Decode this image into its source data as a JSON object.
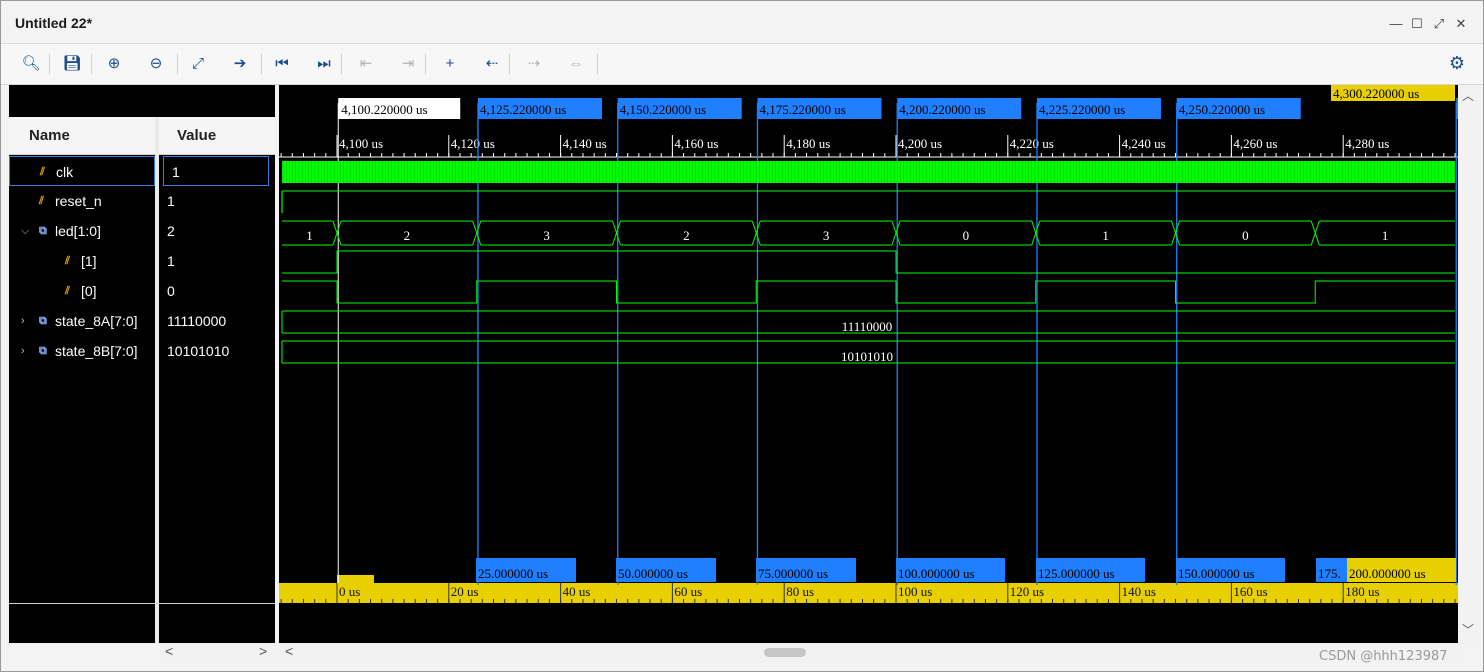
{
  "window": {
    "title": "Untitled 22*"
  },
  "toolbar": {
    "buttons": [
      {
        "name": "zoom-search-icon",
        "glyph": "🔍︎"
      },
      {
        "name": "save-icon",
        "glyph": "💾︎"
      },
      {
        "name": "zoom-in-icon",
        "glyph": "⊕"
      },
      {
        "name": "zoom-out-icon",
        "glyph": "⊖"
      },
      {
        "name": "zoom-fit-icon",
        "glyph": "⤢"
      },
      {
        "name": "go-to-cursor-icon",
        "glyph": "➔"
      },
      {
        "name": "go-to-time-0-icon",
        "glyph": "⏮"
      },
      {
        "name": "go-to-last-time-icon",
        "glyph": "⏭"
      },
      {
        "name": "previous-transition-icon",
        "glyph": "⇤"
      },
      {
        "name": "next-transition-icon",
        "glyph": "⇥"
      },
      {
        "name": "add-marker-icon",
        "glyph": "+"
      },
      {
        "name": "previous-marker-icon",
        "glyph": "⇠"
      },
      {
        "name": "next-marker-icon",
        "glyph": "⇢"
      },
      {
        "name": "swap-cursors-icon",
        "glyph": "⇔"
      }
    ]
  },
  "panels": {
    "name_header": "Name",
    "value_header": "Value"
  },
  "signals": [
    {
      "name": "clk",
      "value": "1",
      "kind": "bit",
      "indent": 0,
      "expander": ""
    },
    {
      "name": "reset_n",
      "value": "1",
      "kind": "bit",
      "indent": 0,
      "expander": ""
    },
    {
      "name": "led[1:0]",
      "value": "2",
      "kind": "bus",
      "indent": 0,
      "expander": "expanded"
    },
    {
      "name": "[1]",
      "value": "1",
      "kind": "bit",
      "indent": 1,
      "expander": ""
    },
    {
      "name": "[0]",
      "value": "0",
      "kind": "bit",
      "indent": 1,
      "expander": ""
    },
    {
      "name": "state_8A[7:0]",
      "value": "11110000",
      "kind": "bus",
      "indent": 0,
      "expander": "collapsed"
    },
    {
      "name": "state_8B[7:0]",
      "value": "10101010",
      "kind": "bus",
      "indent": 0,
      "expander": "collapsed"
    }
  ],
  "timeline": {
    "cursor_label": "4,100.220000 us",
    "marker_labels": [
      "4,125.220000 us",
      "4,150.220000 us",
      "4,175.220000 us",
      "4,200.220000 us",
      "4,225.220000 us",
      "4,250.220000 us",
      "4,300.220000 us"
    ],
    "yellow_marker_label": "4,300.220000 us",
    "ticks": [
      {
        "t": 4100,
        "label": "4,100 us"
      },
      {
        "t": 4120,
        "label": "4,120 us"
      },
      {
        "t": 4140,
        "label": "4,140 us"
      },
      {
        "t": 4160,
        "label": "4,160 us"
      },
      {
        "t": 4180,
        "label": "4,180 us"
      },
      {
        "t": 4200,
        "label": "4,200 us"
      },
      {
        "t": 4220,
        "label": "4,220 us"
      },
      {
        "t": 4240,
        "label": "4,240 us"
      },
      {
        "t": 4260,
        "label": "4,260 us"
      },
      {
        "t": 4280,
        "label": "4,280 us"
      }
    ],
    "delta_labels": [
      "25.000000 us",
      "50.000000 us",
      "75.000000 us",
      "100.000000 us",
      "125.000000 us",
      "150.000000 us",
      "175.",
      "200.000000 us"
    ],
    "relative_ticks": [
      {
        "t": 0,
        "label": "0 us"
      },
      {
        "t": 20,
        "label": "20 us"
      },
      {
        "t": 40,
        "label": "40 us"
      },
      {
        "t": 60,
        "label": "60 us"
      },
      {
        "t": 80,
        "label": "80 us"
      },
      {
        "t": 100,
        "label": "100 us"
      },
      {
        "t": 120,
        "label": "120 us"
      },
      {
        "t": 140,
        "label": "140 us"
      },
      {
        "t": 160,
        "label": "160 us"
      },
      {
        "t": 180,
        "label": "180 us"
      }
    ],
    "led_segments": [
      {
        "value": "1"
      },
      {
        "value": "2"
      },
      {
        "value": "3"
      },
      {
        "value": "2"
      },
      {
        "value": "3"
      },
      {
        "value": "0"
      },
      {
        "value": "1"
      },
      {
        "value": "0"
      },
      {
        "value": "1"
      }
    ],
    "state_8A_value": "11110000",
    "state_8B_value": "10101010"
  },
  "watermark": "CSDN @hhh123987",
  "colors": {
    "wave": "#00ff00",
    "marker": "#1f7fff",
    "yellow": "#e8d000",
    "cursor": "#ffffff"
  }
}
